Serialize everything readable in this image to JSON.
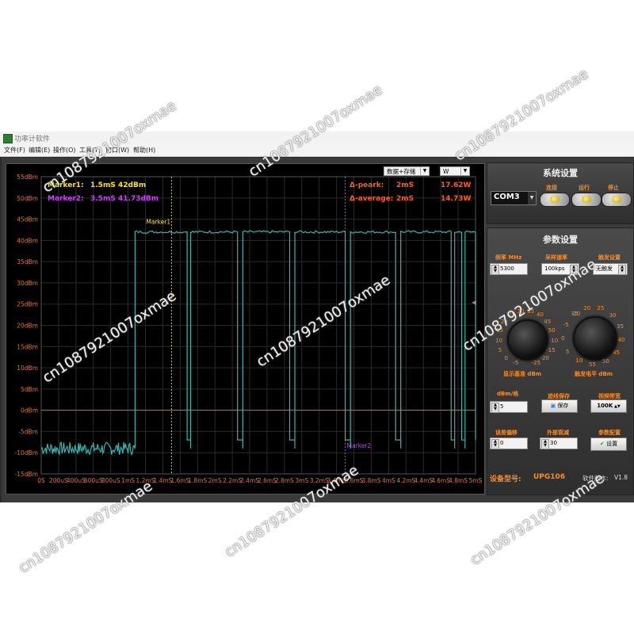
{
  "window": {
    "title": "功率计软件"
  },
  "menu": [
    "文件(F)",
    "编辑(E)",
    "操作(O)",
    "工具(T)",
    "窗口(W)",
    "帮助(H)"
  ],
  "scope": {
    "mode_select": "数据+存储",
    "unit_select": "W",
    "marker1": {
      "label": "Marker1:",
      "time": "1.5mS",
      "value": "42dBm",
      "plot_label": "Marker1"
    },
    "marker2": {
      "label": "Marker2:",
      "time": "3.5mS",
      "value": "41.73dBm",
      "plot_label": "Marker2"
    },
    "delta_peak": {
      "label": "Δ-peark:",
      "time": "2mS",
      "value": "17.62W"
    },
    "delta_average": {
      "label": "Δ-average:",
      "time": "2mS",
      "value": "14.73W"
    }
  },
  "chart_data": {
    "type": "line",
    "y_ticks": [
      "55dBm",
      "50dBm",
      "45dBm",
      "40dBm",
      "35dBm",
      "30dBm",
      "25dBm",
      "20dBm",
      "15dBm",
      "10dBm",
      "5dBm",
      "0dBm",
      "-5dBm",
      "-10dBm",
      "-15dBm"
    ],
    "x_ticks": [
      "0S",
      "200uS",
      "400uS",
      "600uS",
      "800uS",
      "1mS",
      "1.2mS",
      "1.4mS",
      "1.6mS",
      "1.8mS",
      "2mS",
      "2.2mS",
      "2.4mS",
      "2.6mS",
      "2.8mS",
      "3mS",
      "3.2mS",
      "3.4mS",
      "3.6mS",
      "3.8mS",
      "4mS",
      "4.2mS",
      "4.4mS",
      "4.6mS",
      "4.8mS",
      "5mS"
    ],
    "ylim": [
      -15,
      55
    ],
    "xlim_ms": [
      0,
      5
    ],
    "reference_line_dbm": 0,
    "marker1_ms": 1.5,
    "marker2_ms": 3.5,
    "pulses_ms": [
      [
        1.08,
        1.68
      ],
      [
        1.72,
        2.26
      ],
      [
        2.32,
        2.86
      ],
      [
        2.92,
        3.5
      ],
      [
        3.56,
        4.08
      ],
      [
        4.14,
        4.72
      ],
      [
        4.76,
        4.84
      ],
      [
        4.88,
        5.0
      ]
    ],
    "high_dbm": 42,
    "low_dbm": -9,
    "dip_dbm": -7,
    "series": [
      {
        "color": "#2fb8b0"
      }
    ]
  },
  "panel": {
    "system": {
      "title": "系统设置",
      "port": "COM3",
      "connect": "连接",
      "run": "运行",
      "stop": "停止"
    },
    "params": {
      "title": "参数设置",
      "freq_label": "频率 MHz",
      "freq_value": "5300",
      "sample_label": "采样速率",
      "sample_value": "100kps",
      "trigger_label": "触发设置",
      "trigger_value": "无触发",
      "knob1_label": "显示基准 dBm",
      "knob2_label": "触发电平 dBm",
      "knob1_ticks": [
        "-5",
        "0",
        "5",
        "10",
        "15",
        "20",
        "25",
        "30",
        "35",
        "40",
        "45",
        "50",
        "-10",
        "-15",
        "-20",
        "-25"
      ],
      "knob2_ticks": [
        "15",
        "20",
        "25",
        "30",
        "35",
        "40",
        "45",
        "50",
        "55",
        "10",
        "5",
        "0",
        "-5",
        "-10"
      ],
      "per_div_label": "dBm/格",
      "per_div_value": "5",
      "trace_label": "迹线保存",
      "trace_button": "保存",
      "vbw_label": "视频带宽",
      "vbw_value": "100K",
      "offset_label": "误差偏移",
      "offset_value": "0",
      "atten_label": "外部衰减",
      "atten_value": "30",
      "config_label": "参数配置",
      "config_button": "设置",
      "model_label": "设备型号:",
      "model_value": "UPG106",
      "version_label": "软件版本:",
      "version_value": "V1.8"
    }
  },
  "watermark": "cn1087921007oxmae"
}
